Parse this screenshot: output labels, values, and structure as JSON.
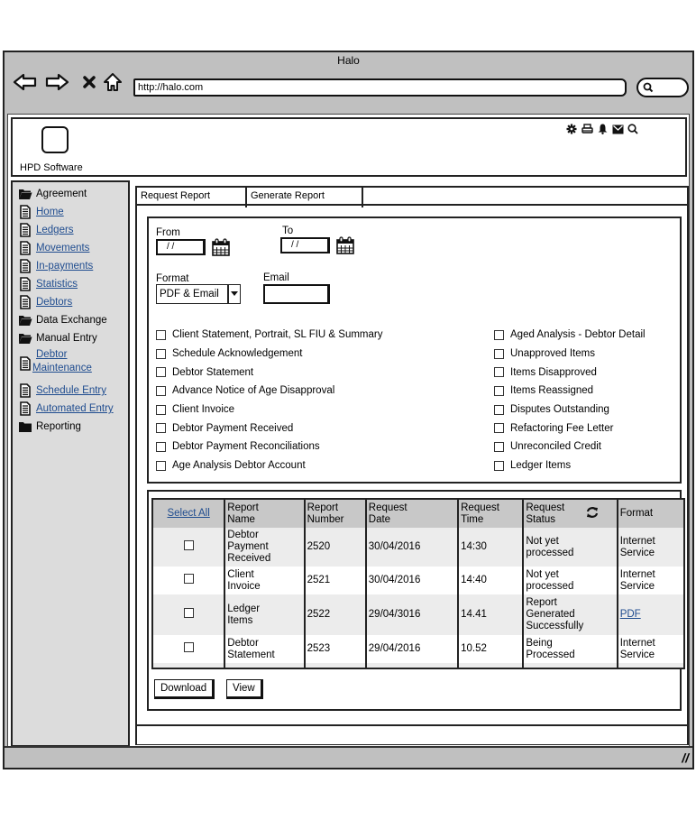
{
  "browser": {
    "title": "Halo",
    "url": "http://halo.com",
    "nav_icons": [
      "back-arrow-icon",
      "forward-arrow-icon",
      "stop-icon",
      "home-icon"
    ],
    "search_icon": "search-icon"
  },
  "header": {
    "logo_text": "HPD Software",
    "icons": [
      "gear-icon",
      "printer-icon",
      "bell-icon",
      "envelope-icon",
      "search-icon"
    ]
  },
  "sidebar": {
    "items": [
      {
        "label": "Agreement",
        "icon": "folder-open-icon",
        "link": false
      },
      {
        "label": "Home",
        "icon": "document-icon",
        "link": true
      },
      {
        "label": "Ledgers",
        "icon": "document-icon",
        "link": true
      },
      {
        "label": "Movements",
        "icon": "document-icon",
        "link": true
      },
      {
        "label": "In-payments",
        "icon": "document-icon",
        "link": true
      },
      {
        "label": "Statistics",
        "icon": "document-icon",
        "link": true
      },
      {
        "label": "Debtors",
        "icon": "document-icon",
        "link": true
      },
      {
        "label": "Data Exchange",
        "icon": "folder-open-icon",
        "link": false
      },
      {
        "label": "Manual Entry",
        "icon": "folder-open-icon",
        "link": false
      },
      {
        "label_line1": "Debtor",
        "label_line2": "Maintenance",
        "icon": "document-icon",
        "link": true
      },
      {
        "label": "Schedule Entry",
        "icon": "document-icon",
        "link": true
      },
      {
        "label": "Automated Entry",
        "icon": "document-icon",
        "link": true
      },
      {
        "label": "Reporting",
        "icon": "folder-closed-icon",
        "link": false
      }
    ]
  },
  "tabs": [
    {
      "label": "Request Report",
      "active": true
    },
    {
      "label": "Generate Report",
      "active": false
    }
  ],
  "filters": {
    "from_label": "From",
    "from_value": "/ /",
    "to_label": "To",
    "to_value": "/ /",
    "format_label": "Format",
    "format_value": "PDF & Email",
    "email_label": "Email",
    "email_value": "",
    "reports_left": [
      "Client Statement, Portrait, SL FIU & Summary",
      "Schedule Acknowledgement",
      "Debtor Statement",
      "Advance Notice of Age Disapproval",
      "Client Invoice",
      "Debtor Payment Received",
      "Debtor Payment Reconciliations",
      "Age Analysis Debtor Account"
    ],
    "reports_right": [
      "Aged Analysis - Debtor Detail",
      "Unapproved Items",
      "Items Disapproved",
      "Items Reassigned",
      "Disputes Outstanding",
      "Refactoring Fee Letter",
      "Unreconciled Credit",
      "Ledger Items"
    ]
  },
  "table": {
    "select_all": "Select All",
    "headers": {
      "name_1": "Report",
      "name_2": "Name",
      "number_1": "Report",
      "number_2": "Number",
      "date_1": "Request",
      "date_2": "Date",
      "time_1": "Request",
      "time_2": "Time",
      "status_1": "Request",
      "status_2": "Status",
      "format": "Format"
    },
    "rows": [
      {
        "name": [
          "Debtor",
          "Payment",
          "Received"
        ],
        "number": "2520",
        "date": "30/04/2016",
        "time": "14:30",
        "status": [
          "Not yet",
          "processed"
        ],
        "format": [
          "Internet",
          "Service"
        ],
        "format_link": false
      },
      {
        "name": [
          "Client",
          "Invoice"
        ],
        "number": "2521",
        "date": "30/04/2016",
        "time": "14:40",
        "status": [
          "Not yet",
          "processed"
        ],
        "format": [
          "Internet",
          "Service"
        ],
        "format_link": false
      },
      {
        "name": [
          "Ledger",
          "Items"
        ],
        "number": "2522",
        "date": "29/04/3016",
        "time": "14.41",
        "status": [
          "Report",
          "Generated",
          "Successfully"
        ],
        "format": [
          "PDF"
        ],
        "format_link": true
      },
      {
        "name": [
          "Debtor",
          "Statement"
        ],
        "number": "2523",
        "date": "29/04/2016",
        "time": "10.52",
        "status": [
          "Being",
          "Processed"
        ],
        "format": [
          "Internet",
          "Service"
        ],
        "format_link": false
      }
    ]
  },
  "buttons": {
    "download": "Download",
    "view": "View"
  },
  "colors": {
    "link": "#1f4c8f",
    "chrome": "#c0c0c0",
    "sidebar": "#dcdcdc",
    "table_header": "#c8c8c8"
  }
}
